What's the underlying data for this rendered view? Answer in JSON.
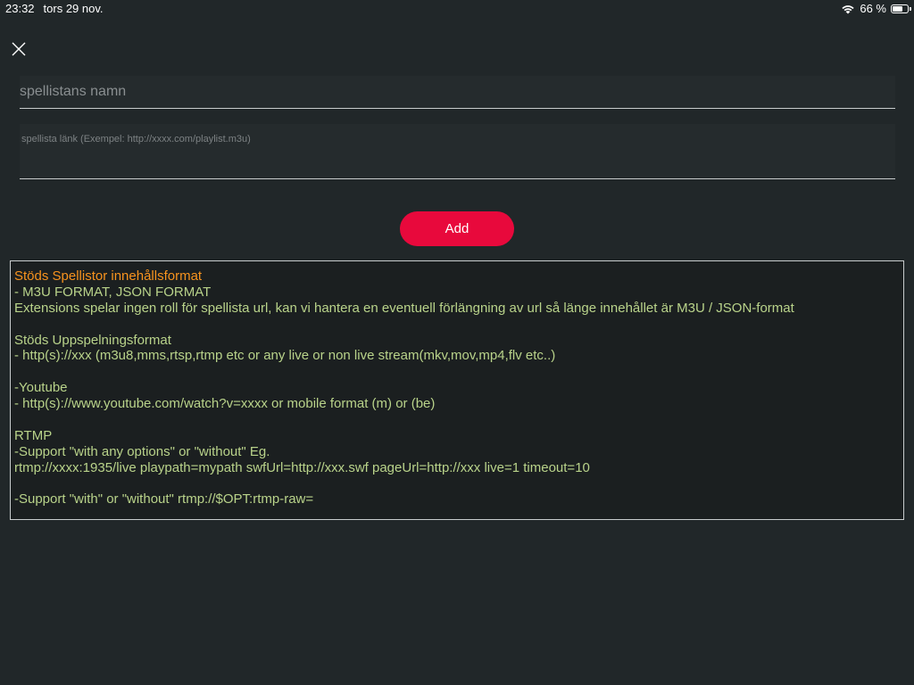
{
  "status_bar": {
    "time": "23:32",
    "date": "tors 29 nov.",
    "battery_percent": "66 %",
    "battery_level": 0.66
  },
  "form": {
    "name_placeholder": "spellistans namn",
    "link_placeholder": "spellista länk (Exempel: http://xxxx.com/playlist.m3u)",
    "add_label": "Add"
  },
  "colors": {
    "background": "#212729",
    "accent": "#e8093c",
    "heading_text": "#f7931e",
    "info_text": "#b9d38a"
  },
  "info": {
    "heading": "Stöds Spellistor innehållsformat",
    "lines": [
      "- M3U FORMAT, JSON FORMAT",
      "Extensions spelar ingen roll för spellista url, kan vi hantera en eventuell förlängning av url så länge innehållet är M3U / JSON-format",
      "",
      "Stöds Uppspelningsformat",
      "- http(s)://xxx (m3u8,mms,rtsp,rtmp etc or any live or non live stream(mkv,mov,mp4,flv etc..)",
      "",
      "-Youtube",
      "- http(s)://www.youtube.com/watch?v=xxxx or mobile format (m) or (be)",
      "",
      "RTMP",
      "-Support \"with any options\" or \"without\" Eg.",
      "rtmp://xxxx:1935/live playpath=mypath swfUrl=http://xxx.swf pageUrl=http://xxx live=1 timeout=10",
      "",
      "-Support \"with\" or \"without\" rtmp://$OPT:rtmp-raw="
    ]
  }
}
